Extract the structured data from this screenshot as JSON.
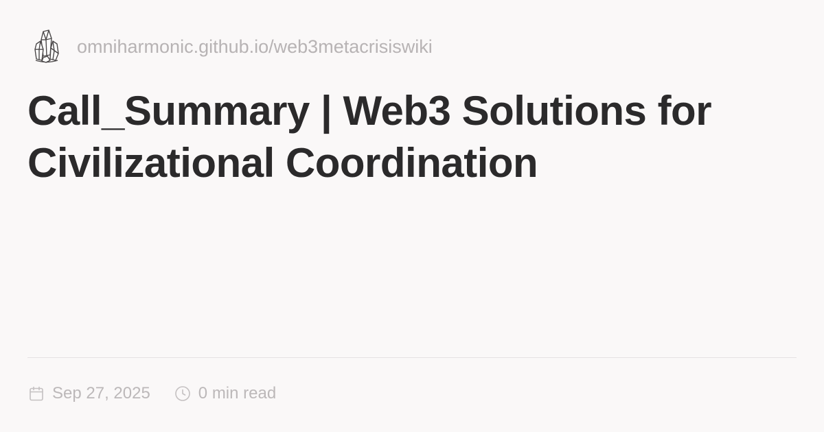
{
  "site": {
    "logo_icon": "crystal-cluster-icon",
    "url": "omniharmonic.github.io/web3metacrisiswiki"
  },
  "article": {
    "title": "Call_Summary | Web3 Solutions for Civilizational Coordination"
  },
  "meta": {
    "date_icon": "calendar-icon",
    "date": "Sep 27, 2025",
    "read_icon": "clock-icon",
    "read_time": "0 min read"
  },
  "colors": {
    "background": "#faf8f8",
    "title": "#2b2a2b",
    "muted": "#b7b3b4",
    "divider": "#e5e2e3"
  }
}
